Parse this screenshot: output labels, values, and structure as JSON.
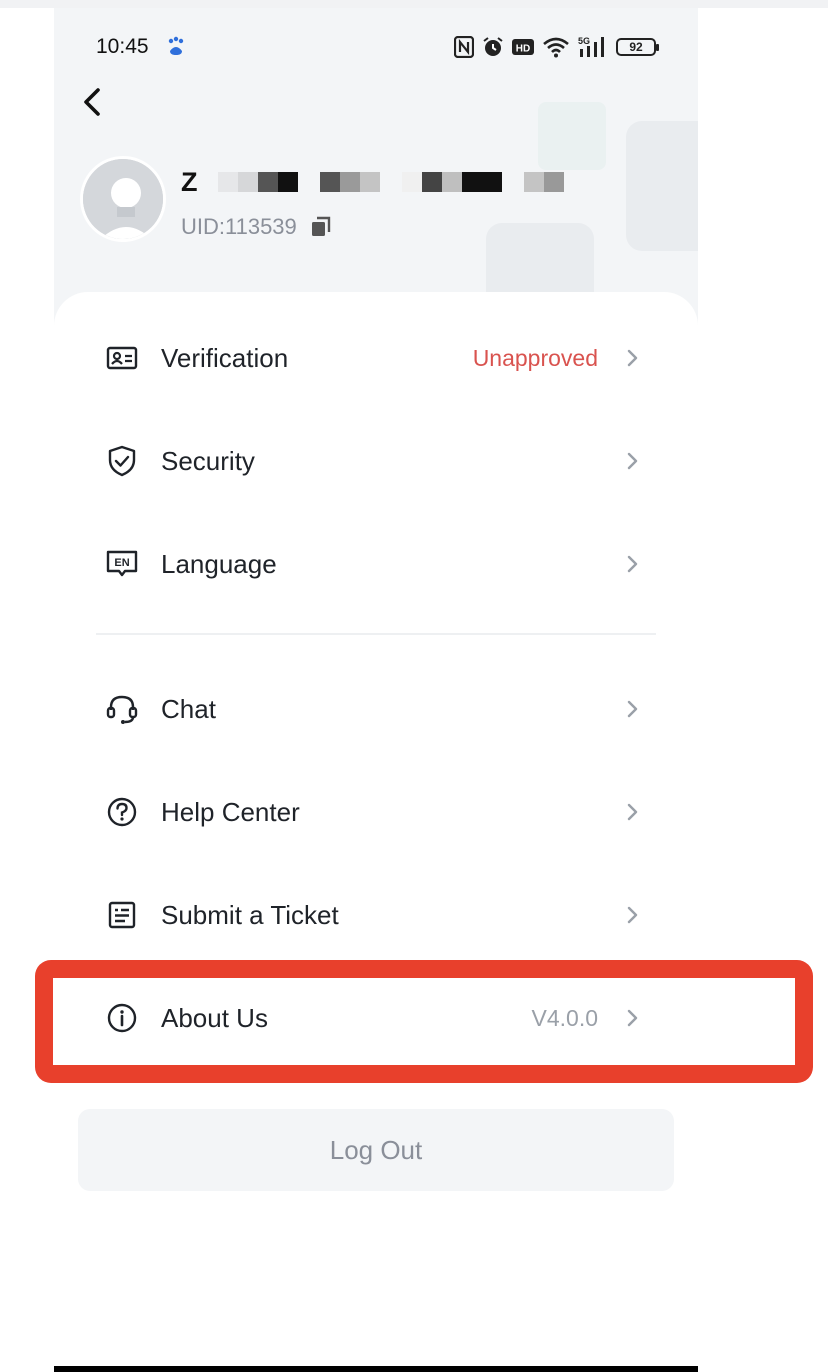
{
  "status_bar": {
    "time": "10:45",
    "network": "5G",
    "battery": "92"
  },
  "header": {
    "back_icon": "chevron-left-icon"
  },
  "profile": {
    "name_initial": "Z",
    "uid": "UID:113539"
  },
  "menu": {
    "verification": {
      "label": "Verification",
      "value": "Unapproved",
      "icon": "id-card-icon"
    },
    "security": {
      "label": "Security",
      "icon": "shield-check-icon"
    },
    "language": {
      "label": "Language",
      "icon": "language-en-icon"
    },
    "chat": {
      "label": "Chat",
      "icon": "headset-icon"
    },
    "help_center": {
      "label": "Help Center",
      "icon": "question-circle-icon"
    },
    "submit_ticket": {
      "label": "Submit a Ticket",
      "icon": "ticket-list-icon"
    },
    "about_us": {
      "label": "About Us",
      "value": "V4.0.0",
      "icon": "info-circle-icon"
    }
  },
  "logout_label": "Log Out",
  "colors": {
    "accent_red": "#d9534f",
    "highlight_border": "#e8402c",
    "header_bg": "#f3f5f7"
  }
}
